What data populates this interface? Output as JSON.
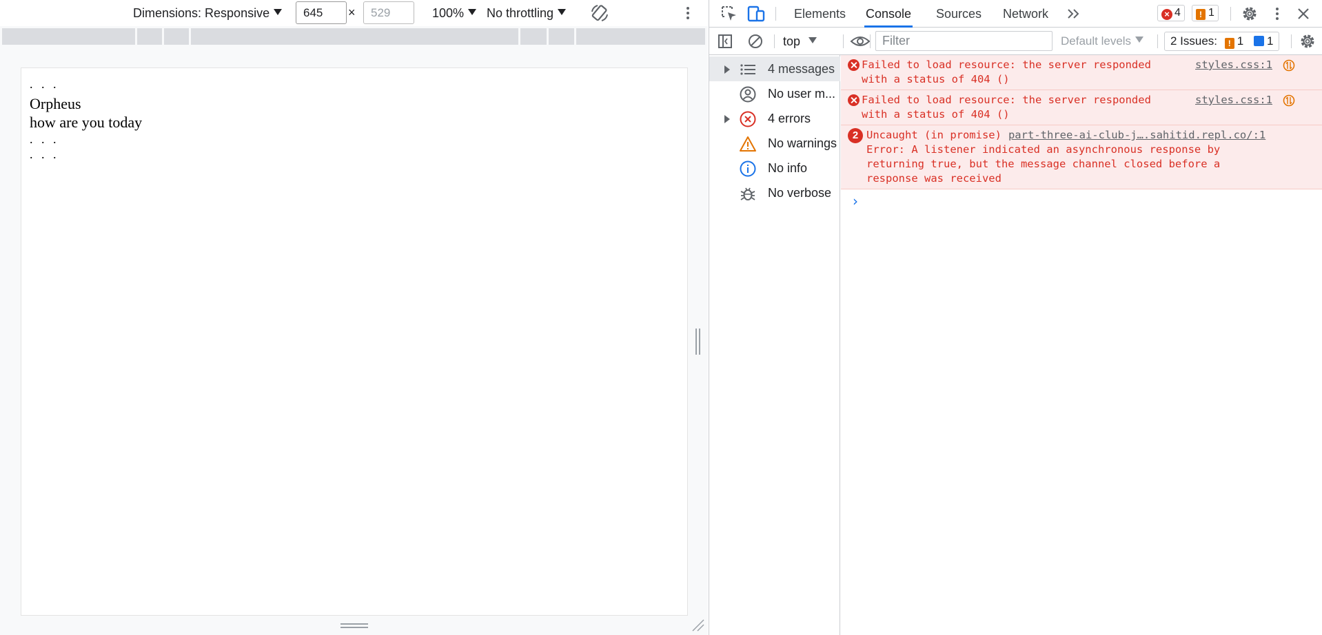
{
  "emulation": {
    "dimensions_label": "Dimensions: Responsive",
    "width": "645",
    "height_placeholder": "529",
    "times": "×",
    "zoom": "100%",
    "throttling": "No throttling"
  },
  "page": {
    "line1": ". . .",
    "line2": "Orpheus",
    "line3": "how are you today",
    "line4": ". . .",
    "line5": ". . ."
  },
  "devtools": {
    "tabs": [
      "Elements",
      "Console",
      "Sources",
      "Network"
    ],
    "active_tab": "Console",
    "error_count": "4",
    "warning_count": "1",
    "issues_label": "2 Issues:",
    "issues_warn": "1",
    "issues_info": "1",
    "context": "top",
    "filter_placeholder": "Filter",
    "levels": "Default levels"
  },
  "sidebar": {
    "items": [
      {
        "label": "4 messages",
        "icon": "list-icon"
      },
      {
        "label": "No user m...",
        "icon": "user-icon"
      },
      {
        "label": "4 errors",
        "icon": "error-icon"
      },
      {
        "label": "No warnings",
        "icon": "warning-icon"
      },
      {
        "label": "No info",
        "icon": "info-icon"
      },
      {
        "label": "No verbose",
        "icon": "bug-icon"
      }
    ]
  },
  "console": {
    "messages": [
      {
        "line1": "Failed to load resource: the server responded",
        "line2": "with a status of 404 ()",
        "source": "styles.css:1"
      },
      {
        "line1": "Failed to load resource: the server responded",
        "line2": "with a status of 404 ()",
        "source": "styles.css:1"
      },
      {
        "repeat": "2",
        "line1": "Uncaught (in promise)",
        "source": "part-three-ai-club-j….sahitid.repl.co/:1",
        "line2": "Error: A listener indicated an asynchronous response by",
        "line3": "returning true, but the message channel closed before a",
        "line4": "response was received"
      }
    ],
    "prompt": "›"
  },
  "colors": {
    "accent": "#1a73e8",
    "error": "#d93025",
    "error_bg": "#fcebeb",
    "warning": "#e37400"
  }
}
